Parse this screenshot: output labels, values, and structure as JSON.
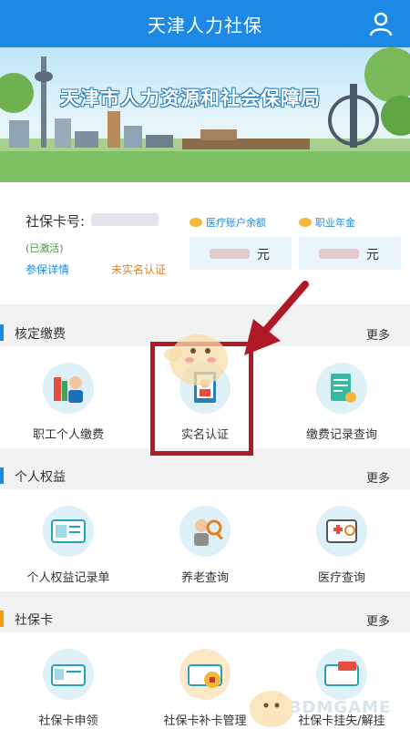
{
  "app": {
    "title": "天津人力社保"
  },
  "banner": {
    "title": "天津市人力资源和社会保障局"
  },
  "card": {
    "card_no_label": "社保卡号:",
    "status": "(已激活)",
    "detail_link": "参保详情",
    "verify_status": "未实名认证"
  },
  "balances": [
    {
      "label": "医疗账户余额",
      "unit": "元"
    },
    {
      "label": "职业年金",
      "unit": "元"
    }
  ],
  "sections": [
    {
      "name": "核定缴费",
      "more": "更多",
      "accent": "#1e88e5",
      "items": [
        {
          "label": "职工个人缴费",
          "icon": "employee-payment-icon"
        },
        {
          "label": "实名认证",
          "icon": "real-name-auth-icon"
        },
        {
          "label": "缴费记录查询",
          "icon": "payment-record-icon"
        }
      ]
    },
    {
      "name": "个人权益",
      "more": "更多",
      "accent": "#1e88e5",
      "items": [
        {
          "label": "个人权益记录单",
          "icon": "rights-record-icon"
        },
        {
          "label": "养老查询",
          "icon": "pension-query-icon"
        },
        {
          "label": "医疗查询",
          "icon": "medical-query-icon"
        }
      ]
    },
    {
      "name": "社保卡",
      "more": "更多",
      "accent": "#f39c12",
      "items": [
        {
          "label": "社保卡申领",
          "icon": "card-apply-icon"
        },
        {
          "label": "社保卡补卡管理",
          "icon": "card-replace-icon"
        },
        {
          "label": "社保卡挂失/解挂",
          "icon": "card-lost-icon"
        }
      ]
    }
  ],
  "watermark": {
    "text": "3DMGAME"
  }
}
